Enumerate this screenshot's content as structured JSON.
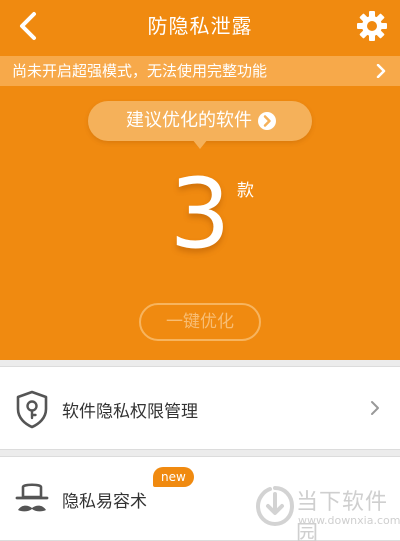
{
  "header": {
    "title": "防隐私泄露",
    "back_icon": "back-arrow-icon",
    "settings_icon": "gear-icon"
  },
  "notice": {
    "text": "尚未开启超强模式，无法使用完整功能"
  },
  "suggestion": {
    "label": "建议优化的软件",
    "count": "3",
    "unit": "款",
    "optimize_label": "一键优化"
  },
  "menu": [
    {
      "label": "软件隐私权限管理",
      "icon": "shield-key-icon"
    },
    {
      "label": "隐私易容术",
      "icon": "hat-mustache-icon",
      "badge": "new"
    }
  ],
  "watermark": {
    "name": "当下软件园",
    "url": "www.downxia.com"
  },
  "colors": {
    "primary": "#f08a10",
    "notice_bg": "#f7a94a",
    "page_bg": "#ececec"
  }
}
